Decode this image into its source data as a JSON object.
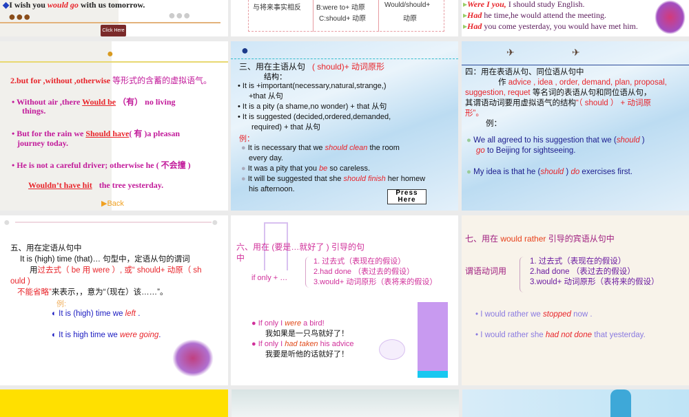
{
  "slides": [
    {
      "lines": [
        "I wish you ",
        "would go",
        " with us tomorrow."
      ],
      "button": "Click Here"
    },
    {
      "cells": [
        "与将来事实相反",
        "B:were to+ 动原",
        "C:should+ 动原",
        "Would/should+",
        "动原"
      ]
    },
    {
      "lines": [
        [
          "Were I you,",
          " I should study English."
        ],
        [
          "Had",
          " he time,he would attend the meeting."
        ],
        [
          "Had",
          " you come yesterday, you would have met him."
        ]
      ]
    },
    {
      "title_a": "2.but for ,without ,otherwise ",
      "title_b": "等形式的含蓄的虚拟语气。",
      "items": [
        [
          "Without air ,there ",
          "Would   be",
          "（有） no living"
        ],
        [
          "things."
        ],
        [
          "But for the rain we ",
          "Should have",
          "( 有 )a pleasan"
        ],
        [
          "journey today."
        ],
        [
          "He is not a careful driver; otherwise he ( 不会撞 )"
        ],
        [
          "Wouldn’t have hit",
          "the tree yesterday."
        ]
      ],
      "back": "Back"
    },
    {
      "title": "三、用在主语从句",
      "title_red": "( should)+ 动词原形",
      "struct": "结构：",
      "bullets": [
        "It is +important(necessary,natural,strange,)",
        "+that 从句",
        "It is a pity (a shame,no wonder) + that 从句",
        "It is suggested (decided,ordered,demanded,",
        "required) + that 从句"
      ],
      "example": "例：",
      "ex": [
        [
          "It is necessary that we ",
          "should clean",
          " the room"
        ],
        [
          "every day."
        ],
        [
          "It was a pity that you ",
          "be",
          " so careless."
        ],
        [
          "It will be suggested that she ",
          "should finish",
          " her homew"
        ],
        [
          "his afternoon."
        ]
      ],
      "press": [
        "Press",
        "Here"
      ]
    },
    {
      "title": "四：用在表语从句、同位语从句中",
      "l1a": "作 ",
      "l1b": "advice , idea , order, demand, plan, proposal,",
      "l2a": "suggestion, requet",
      "l2b": " 等名词的表语从句和同位语从句，",
      "l3a": "其谓语动词要用虚拟语气的结构",
      "l3b": "“（ should ） + 动词原",
      "l4": "形”。",
      "example": "例：",
      "ex1": [
        "We all agreed to his suggestion that we (",
        "should",
        " )"
      ],
      "ex1b": [
        "go",
        " to Beijing for sightseeing."
      ],
      "ex2": [
        "My idea is that he (",
        "should",
        " ) ",
        "do",
        " exercises first."
      ]
    },
    {
      "title": "五、用在定语从句中",
      "l1": "It is (high) time  (that)… 句型中，定语从句的谓词",
      "l2a": "用",
      "l2b": "过去式（ be 用 were ）, 或“ should+ 动原（ sh",
      "l3": "ould )",
      "l4a": "不能省略”",
      "l4b": "来表示，，意为“（现在）该……”。",
      "example": "例:",
      "ex1": [
        "It is (high) time we ",
        "left",
        " ."
      ],
      "ex2": [
        "It is high time we ",
        "were going",
        "."
      ]
    },
    {
      "title": "六、用在  (要是…就好了 ) 引导的句",
      "title2": "中",
      "ifonly": "if only + …",
      "forms": [
        "1. 过去式（表现在的假设）",
        "2.had done  （表过去的假设）",
        "3.would+ 动词原形（表将来的假设）"
      ],
      "ex": [
        [
          "If only I ",
          "were",
          " a bird!"
        ],
        [
          "我如果是一只鸟就好了！"
        ],
        [
          "If only I ",
          "had taken",
          " his advice"
        ],
        [
          "我要是听他的话就好了！"
        ]
      ]
    },
    {
      "title_a": "七、用在 ",
      "title_b": "would rather",
      "title_c": "  引导的宾语从句中",
      "label": "谓语动词用",
      "forms": [
        "1. 过去式（表现在的假设）",
        "2.had done  （表过去的假设）",
        "3.would+ 动词原形（表将来的假设）"
      ],
      "ex1": [
        "I would rather we ",
        "stopped",
        " now ."
      ],
      "ex2": [
        "I would rather  she ",
        "had not done",
        " that yesterday."
      ]
    }
  ],
  "colors": {
    "background": "#ebebeb",
    "red": "#e8242a",
    "magenta": "#c21a9a",
    "navy": "#1a1a8c"
  }
}
